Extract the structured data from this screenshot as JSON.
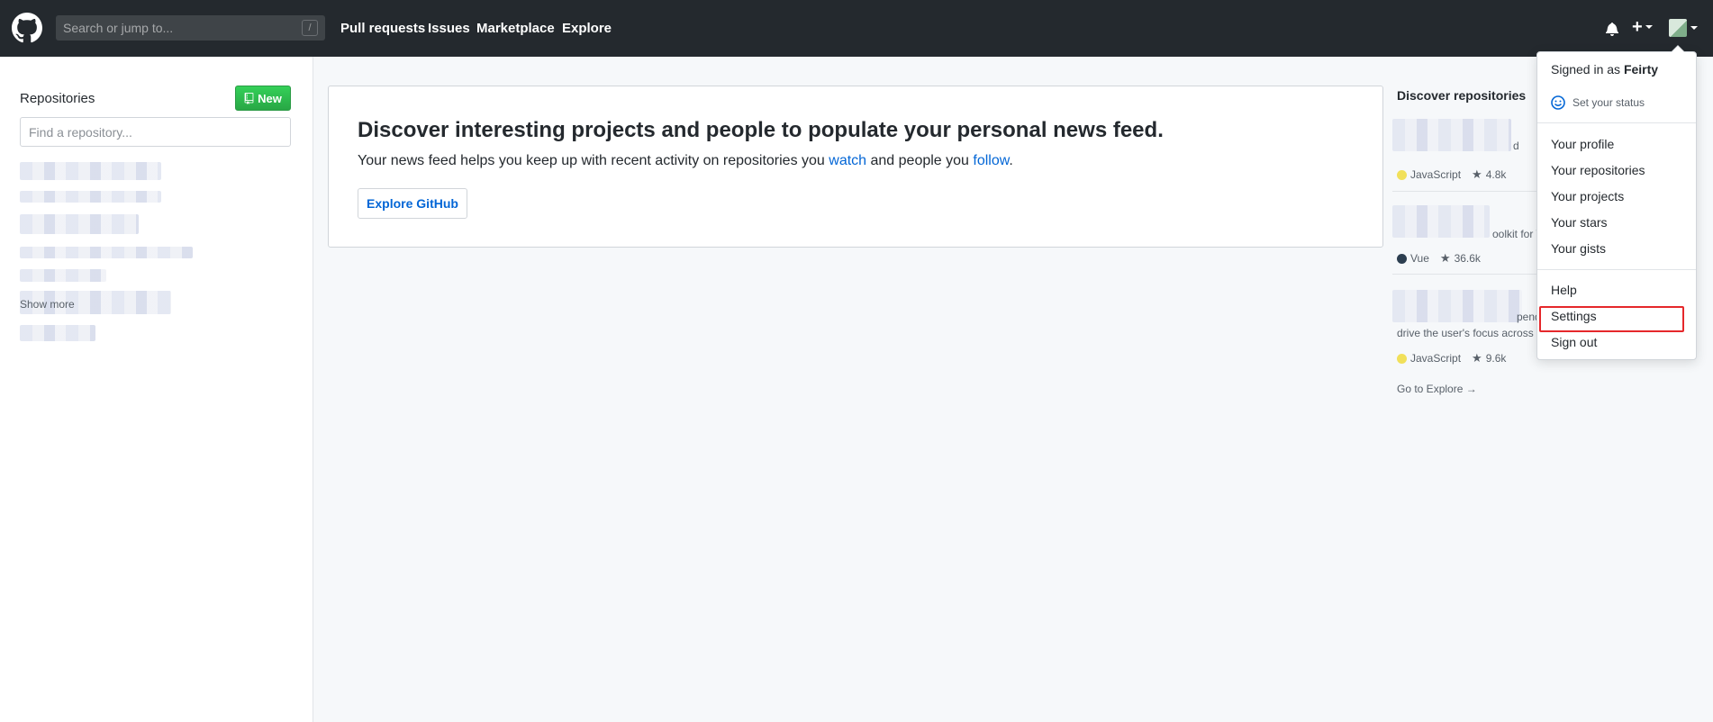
{
  "header": {
    "search_placeholder": "Search or jump to...",
    "search_key": "/",
    "nav": [
      "Pull requests",
      "Issues",
      "Marketplace",
      "Explore"
    ]
  },
  "sidebar": {
    "title": "Repositories",
    "new_label": "New",
    "find_placeholder": "Find a repository...",
    "show_more": "Show more"
  },
  "feed": {
    "heading": "Discover interesting projects and people to populate your personal news feed.",
    "text_before": "Your news feed helps you keep up with recent activity on repositories you ",
    "watch": "watch",
    "text_middle": " and people you ",
    "follow": "follow",
    "text_after": ".",
    "explore_button": "Explore GitHub"
  },
  "discover": {
    "title": "Discover repositories",
    "repos": [
      {
        "fragment": "d",
        "language": "JavaScript",
        "lang_color": "#f1e05a",
        "stars": "4.8k"
      },
      {
        "fragment": "oolkit for Web",
        "language": "Vue",
        "lang_color": "#2c3e50",
        "stars": "36.6k"
      },
      {
        "fragment": "pendenc",
        "fragment2": "drive the user's focus across t",
        "language": "JavaScript",
        "lang_color": "#f1e05a",
        "stars": "9.6k"
      }
    ],
    "go_explore": "Go to Explore →"
  },
  "dropdown": {
    "signed_in_prefix": "Signed in as ",
    "username": "Feirty",
    "set_status": "Set your status",
    "items": [
      "Your profile",
      "Your repositories",
      "Your projects",
      "Your stars",
      "Your gists"
    ],
    "help": "Help",
    "settings": "Settings",
    "sign_out": "Sign out"
  },
  "colors": {
    "header_bg": "#24292e",
    "link": "#0366d6",
    "highlight": "#e5282b"
  }
}
